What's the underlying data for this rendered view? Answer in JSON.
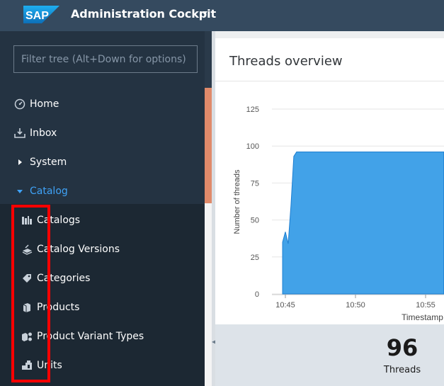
{
  "header": {
    "logo_text": "SAP",
    "app_title": "Administration Cockpit"
  },
  "sidebar": {
    "filter_placeholder": "Filter tree (Alt+Down for options)",
    "items": [
      {
        "label": "Home",
        "icon": "dashboard-icon"
      },
      {
        "label": "Inbox",
        "icon": "inbox-icon"
      },
      {
        "label": "System",
        "icon": "caret-right-icon"
      },
      {
        "label": "Catalog",
        "icon": "caret-down-icon"
      }
    ],
    "catalog_children": [
      {
        "label": "Catalogs",
        "icon": "catalogs-icon"
      },
      {
        "label": "Catalog Versions",
        "icon": "catalog-versions-icon"
      },
      {
        "label": "Categories",
        "icon": "tag-icon"
      },
      {
        "label": "Products",
        "icon": "product-icon"
      },
      {
        "label": "Product Variant Types",
        "icon": "variant-types-icon"
      },
      {
        "label": "Units",
        "icon": "units-icon"
      }
    ]
  },
  "main": {
    "card_title": "Threads overview",
    "kpi": {
      "value": "96",
      "label": "Threads"
    }
  },
  "chart_data": {
    "type": "area",
    "title": "",
    "xlabel": "Timestamp",
    "ylabel": "Number of threads",
    "x_ticks": [
      "10:45",
      "10:50",
      "10:55"
    ],
    "y_ticks": [
      0,
      25,
      50,
      75,
      100,
      125
    ],
    "ylim": [
      0,
      125
    ],
    "grid": true,
    "color": "#42a2e8",
    "series": [
      {
        "x": [
          "10:44.8",
          "10:45.0",
          "10:45.2",
          "10:45.4",
          "10:45.6",
          "10:45.8",
          "10:46.0",
          "10:50",
          "10:55",
          "10:56.3"
        ],
        "values": [
          35,
          42,
          34,
          60,
          93,
          96,
          96,
          96,
          96,
          96
        ]
      }
    ]
  },
  "colors": {
    "header_bg": "#354a5f",
    "sidebar_bg": "#1c2833",
    "active_text": "#3fa2f6",
    "chart_fill": "#42a2e8",
    "highlight": "#ff0000"
  }
}
